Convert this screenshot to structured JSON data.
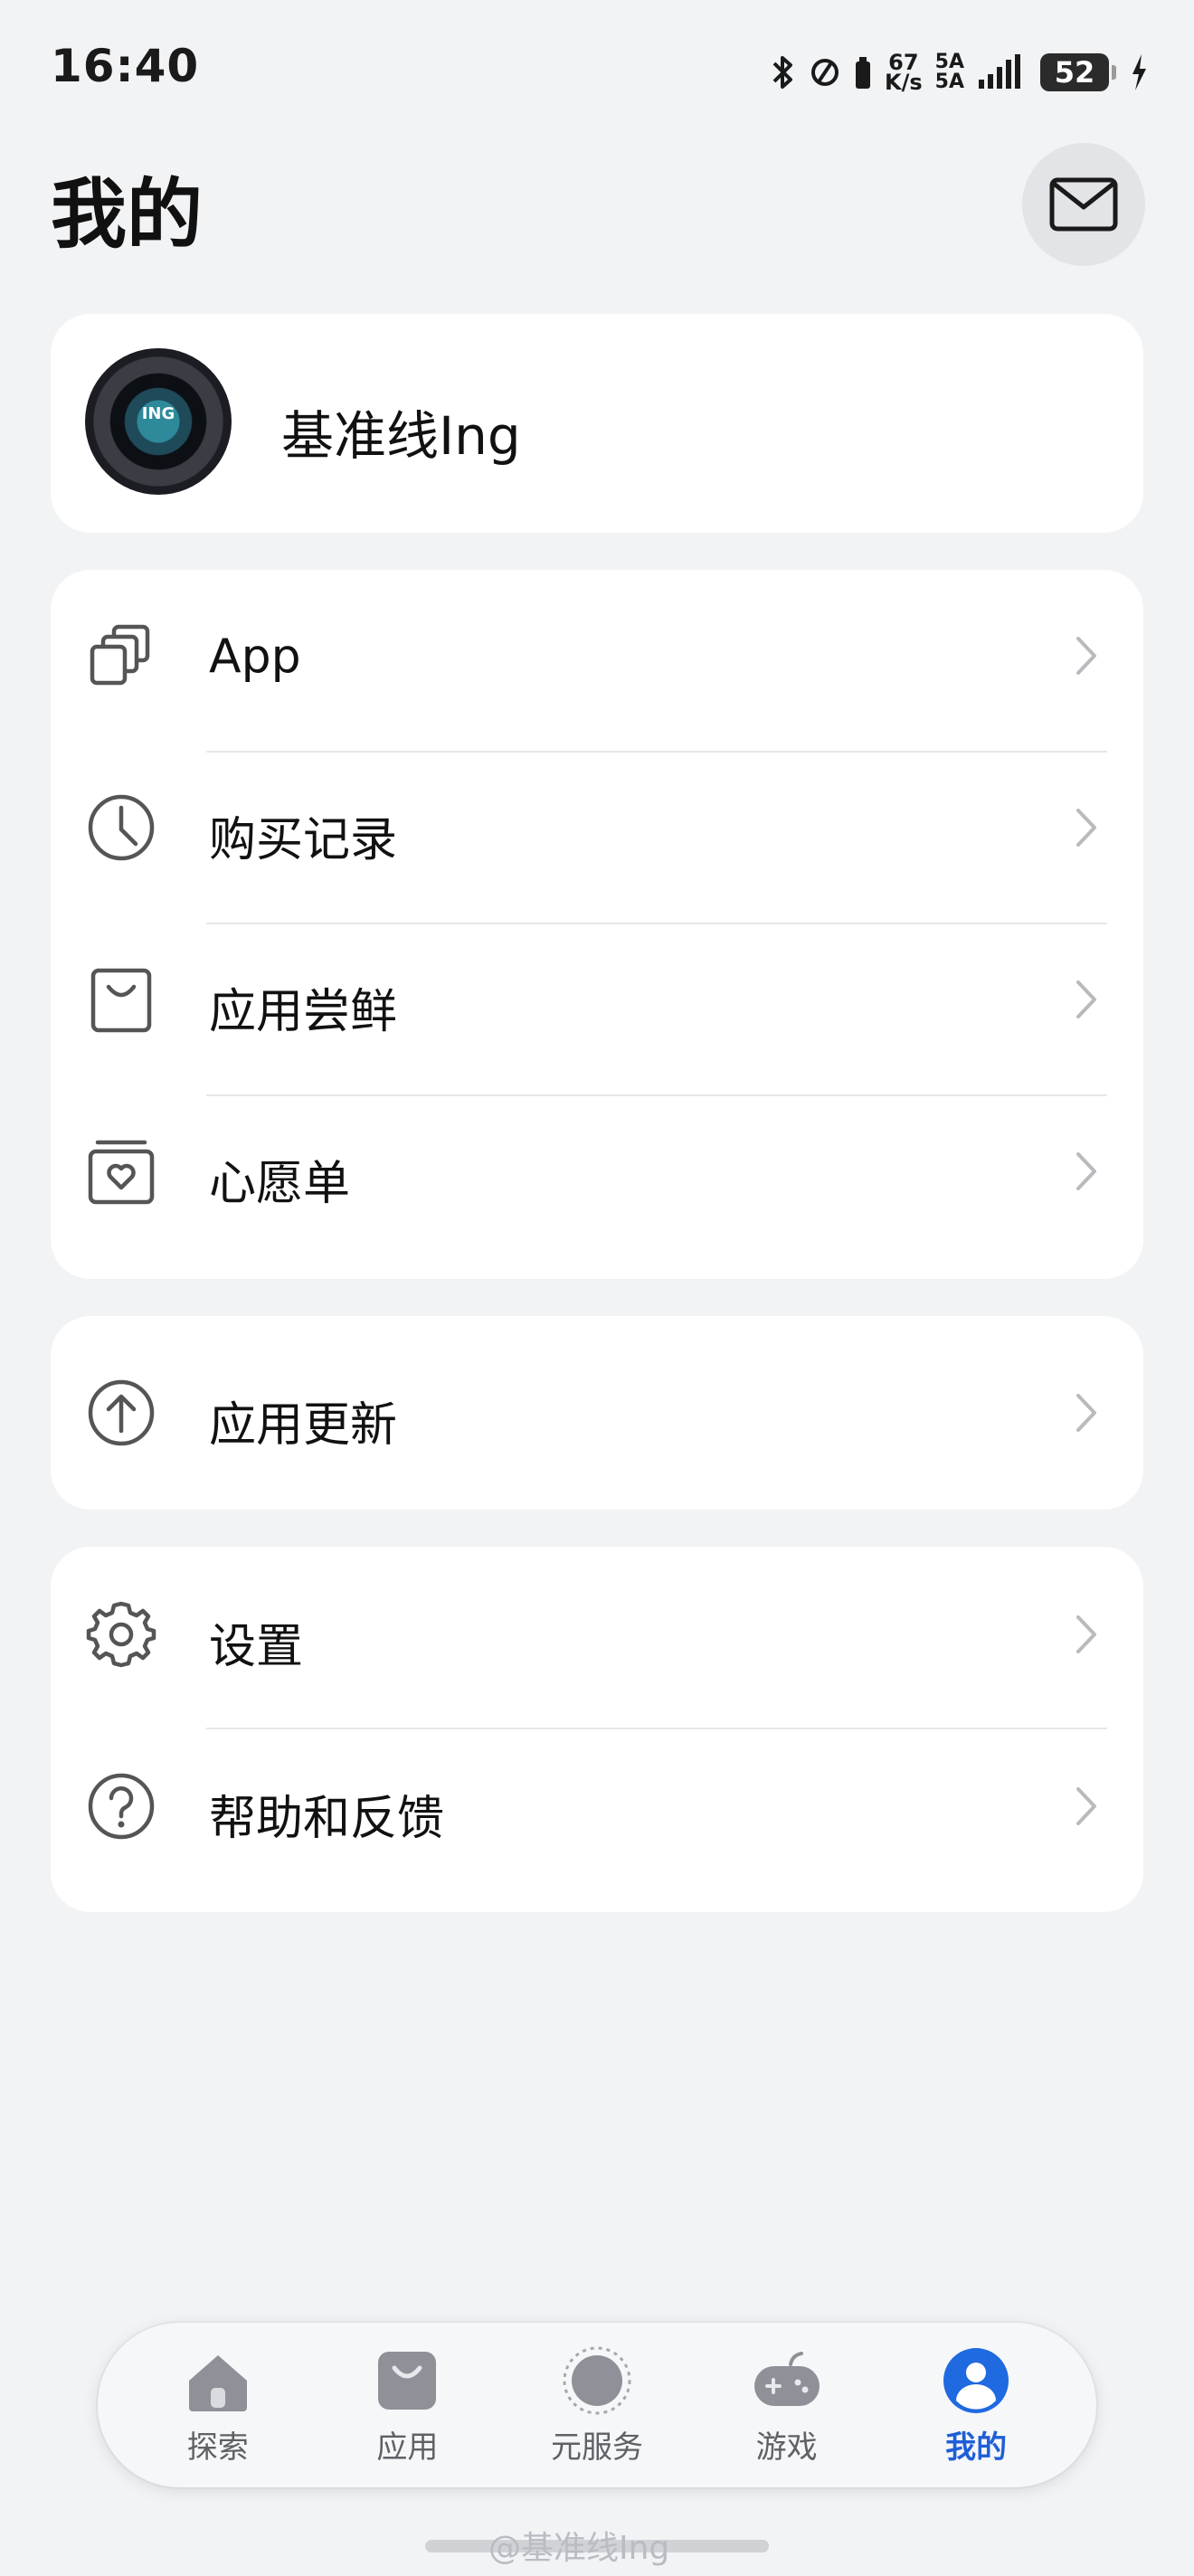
{
  "status_bar": {
    "time": "16:40",
    "net_speed_value": "67",
    "net_speed_unit": "K/s",
    "signal_1": "5A",
    "signal_2": "5A",
    "battery_level": "52"
  },
  "header": {
    "title": "我的",
    "mail_icon": "mail-icon"
  },
  "profile": {
    "name": "基准线Ing",
    "avatar_text": "ING"
  },
  "menu_group_1": [
    {
      "label": "App",
      "icon": "apps-stack-icon"
    },
    {
      "label": "购买记录",
      "icon": "clock-icon"
    },
    {
      "label": "应用尝鲜",
      "icon": "shopping-bag-icon"
    },
    {
      "label": "心愿单",
      "icon": "heart-box-icon"
    }
  ],
  "menu_group_2": [
    {
      "label": "应用更新",
      "icon": "arrow-up-circle-icon"
    }
  ],
  "menu_group_3": [
    {
      "label": "设置",
      "icon": "gear-icon"
    },
    {
      "label": "帮助和反馈",
      "icon": "question-circle-icon"
    }
  ],
  "tab_bar": {
    "tabs": [
      {
        "label": "探索",
        "icon": "home-icon",
        "active": false
      },
      {
        "label": "应用",
        "icon": "bag-icon",
        "active": false
      },
      {
        "label": "元服务",
        "icon": "atom-service-icon",
        "active": false
      },
      {
        "label": "游戏",
        "icon": "gamepad-icon",
        "active": false
      },
      {
        "label": "我的",
        "icon": "person-icon",
        "active": true
      }
    ],
    "accent_color": "#1f5fd6",
    "inactive_color": "#5f6166"
  },
  "watermark": "@基准线Ing"
}
